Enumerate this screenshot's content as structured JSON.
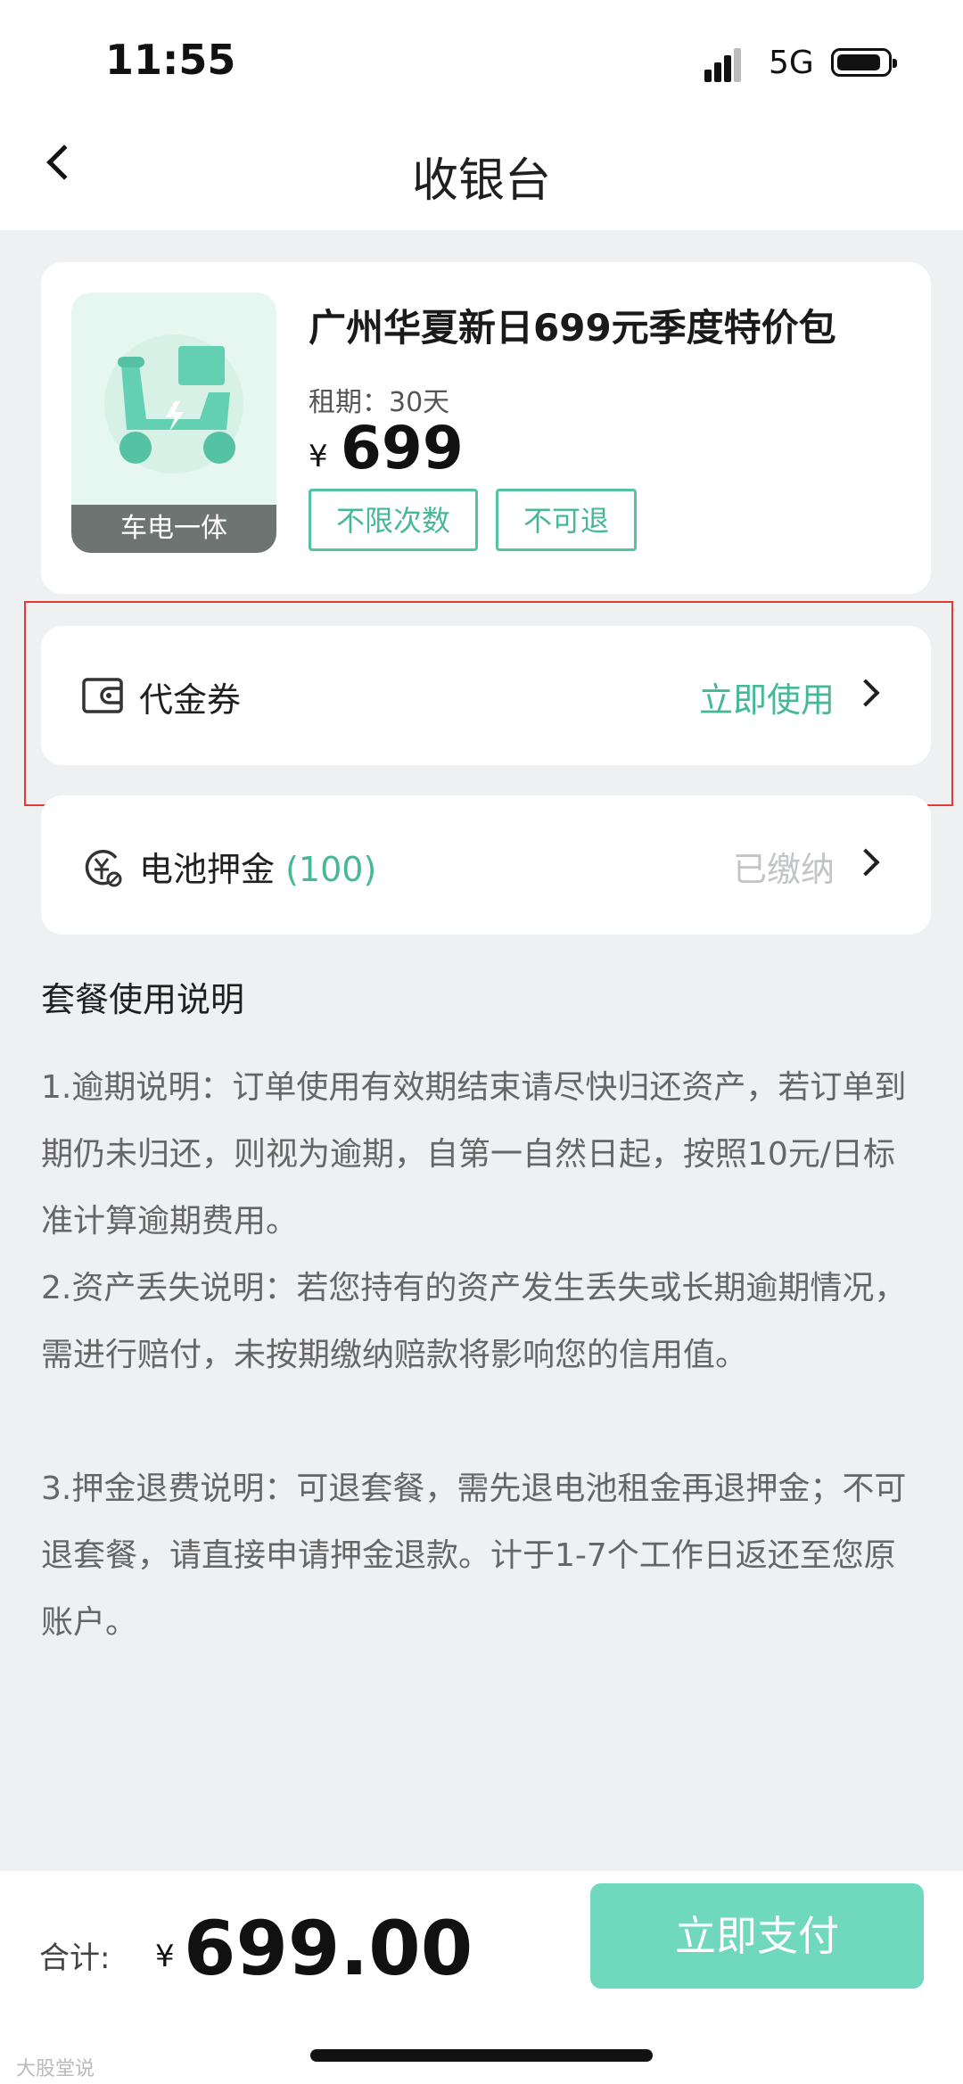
{
  "status_bar": {
    "time": "11:55",
    "network": "5G",
    "icons": [
      "signal-icon",
      "battery-icon"
    ]
  },
  "header": {
    "title": "收银台",
    "back_icon": "chevron-left-icon"
  },
  "product": {
    "name": "广州华夏新日699元季度特价包",
    "thumb_label": "车电一体",
    "thumb_icon": "scooter-icon",
    "term": "租期：30天",
    "currency": "¥",
    "price": "699",
    "tags": [
      "不限次数",
      "不可退"
    ]
  },
  "coupon": {
    "icon": "wallet-icon",
    "label": "代金券",
    "action": "立即使用"
  },
  "deposit": {
    "icon": "yuan-coin-icon",
    "label": "电池押金",
    "count": "(100)",
    "status": "已缴纳"
  },
  "instructions": {
    "title": "套餐使用说明",
    "items": [
      "1.逾期说明：订单使用有效期结束请尽快归还资产，若订单到期仍未归还，则视为逾期，自第一自然日起，按照10元/日标准计算逾期费用。",
      "2.资产丢失说明：若您持有的资产发生丢失或长期逾期情况，需进行赔付，未按期缴纳赔款将影响您的信用值。",
      "3.押金退费说明：可退套餐，需先退电池租金再退押金；不可退套餐，请直接申请押金退款。计于1-7个工作日返还至您原账户。"
    ]
  },
  "footer": {
    "total_label": "合计:",
    "currency": "¥",
    "total": "699.00",
    "pay_button": "立即支付"
  },
  "watermark": "大股堂说",
  "colors": {
    "accent": "#45b896",
    "button": "#6fd8bd",
    "highlight_border": "#e53935",
    "background": "#eef0f2"
  }
}
